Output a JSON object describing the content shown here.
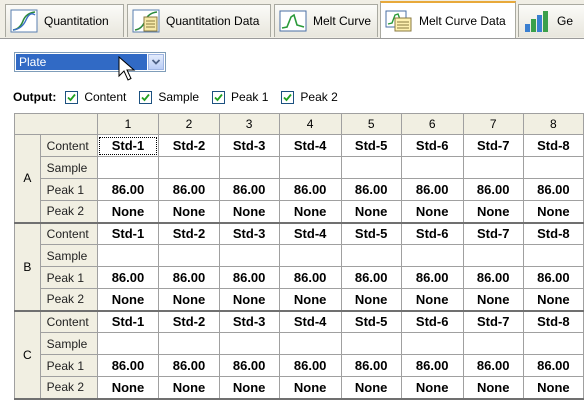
{
  "tabs": [
    {
      "label": "Quantitation",
      "icon": "quantitation-icon",
      "active": false
    },
    {
      "label": "Quantitation Data",
      "icon": "quantitation-data-icon",
      "active": false
    },
    {
      "label": "Melt Curve",
      "icon": "melt-curve-icon",
      "active": false
    },
    {
      "label": "Melt Curve Data",
      "icon": "melt-curve-data-icon",
      "active": true
    },
    {
      "label": "Ge",
      "icon": "gene-expression-icon",
      "active": false
    }
  ],
  "plate_select": {
    "value": "Plate"
  },
  "output": {
    "label": "Output:",
    "options": [
      {
        "label": "Content",
        "checked": true
      },
      {
        "label": "Sample",
        "checked": true
      },
      {
        "label": "Peak 1",
        "checked": true
      },
      {
        "label": "Peak 2",
        "checked": true
      }
    ]
  },
  "grid": {
    "columns": [
      "1",
      "2",
      "3",
      "4",
      "5",
      "6",
      "7",
      "8"
    ],
    "field_labels": [
      "Content",
      "Sample",
      "Peak 1",
      "Peak 2"
    ],
    "rows": [
      {
        "row": "A",
        "content": [
          "Std-1",
          "Std-2",
          "Std-3",
          "Std-4",
          "Std-5",
          "Std-6",
          "Std-7",
          "Std-8"
        ],
        "sample": [
          "",
          "",
          "",
          "",
          "",
          "",
          "",
          ""
        ],
        "peak1": [
          "86.00",
          "86.00",
          "86.00",
          "86.00",
          "86.00",
          "86.00",
          "86.00",
          "86.00"
        ],
        "peak2": [
          "None",
          "None",
          "None",
          "None",
          "None",
          "None",
          "None",
          "None"
        ]
      },
      {
        "row": "B",
        "content": [
          "Std-1",
          "Std-2",
          "Std-3",
          "Std-4",
          "Std-5",
          "Std-6",
          "Std-7",
          "Std-8"
        ],
        "sample": [
          "",
          "",
          "",
          "",
          "",
          "",
          "",
          ""
        ],
        "peak1": [
          "86.00",
          "86.00",
          "86.00",
          "86.00",
          "86.00",
          "86.00",
          "86.00",
          "86.00"
        ],
        "peak2": [
          "None",
          "None",
          "None",
          "None",
          "None",
          "None",
          "None",
          "None"
        ]
      },
      {
        "row": "C",
        "content": [
          "Std-1",
          "Std-2",
          "Std-3",
          "Std-4",
          "Std-5",
          "Std-6",
          "Std-7",
          "Std-8"
        ],
        "sample": [
          "",
          "",
          "",
          "",
          "",
          "",
          "",
          ""
        ],
        "peak1": [
          "86.00",
          "86.00",
          "86.00",
          "86.00",
          "86.00",
          "86.00",
          "86.00",
          "86.00"
        ],
        "peak2": [
          "None",
          "None",
          "None",
          "None",
          "None",
          "None",
          "None",
          "None"
        ]
      }
    ]
  },
  "colors": {
    "selection": "#316ac5",
    "tab_active_accent": "#e8a93a",
    "header_bg": "#f1efe2"
  }
}
